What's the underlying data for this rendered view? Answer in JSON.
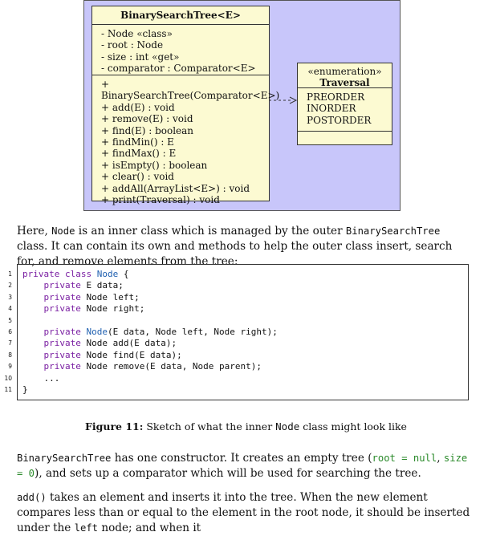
{
  "uml": {
    "class_box": {
      "title": "BinarySearchTree<E>",
      "attributes": [
        "- Node «class»",
        "- root : Node",
        "- size : int «get»",
        "- comparator : Comparator<E>"
      ],
      "operations": [
        "+ BinarySearchTree(Comparator<E>)",
        "+ add(E) : void",
        "+ remove(E) : void",
        "+ find(E) : boolean",
        "+ findMin() : E",
        "+ findMax() : E",
        "+ isEmpty() : boolean",
        "+ clear() : void",
        "+ addAll(ArrayList<E>) : void",
        "+ print(Traversal) : void"
      ]
    },
    "enum_box": {
      "stereotype": "«enumeration»",
      "title": "Traversal",
      "values": [
        "PREORDER",
        "INORDER",
        "POSTORDER"
      ]
    }
  },
  "para1": {
    "t1": "Here, ",
    "c1": "Node",
    "t2": " is an inner class which is managed by the outer ",
    "c2": "BinarySearchTree",
    "t3": " class. It can contain its own and methods to help the outer class insert, search for, and remove elements from the tree:"
  },
  "code": {
    "line_numbers": [
      "1",
      "2",
      "3",
      "4",
      "5",
      "6",
      "7",
      "8",
      "9",
      "10",
      "11"
    ],
    "lines": [
      {
        "kw": "private class ",
        "fn": "Node",
        "rest": " {"
      },
      {
        "kw": "    private ",
        "fn": "",
        "rest": "E data;"
      },
      {
        "kw": "    private ",
        "fn": "",
        "rest": "Node left;"
      },
      {
        "kw": "    private ",
        "fn": "",
        "rest": "Node right;"
      },
      {
        "kw": "",
        "fn": "",
        "rest": ""
      },
      {
        "kw": "    private ",
        "fn": "Node",
        "rest": "(E data, Node left, Node right);"
      },
      {
        "kw": "    private ",
        "fn": "",
        "rest": "Node add(E data);"
      },
      {
        "kw": "    private ",
        "fn": "",
        "rest": "Node find(E data);"
      },
      {
        "kw": "    private ",
        "fn": "",
        "rest": "Node remove(E data, Node parent);"
      },
      {
        "kw": "",
        "fn": "",
        "rest": "    ..."
      },
      {
        "kw": "",
        "fn": "",
        "rest": "}"
      }
    ]
  },
  "caption": {
    "label": "Figure 11:",
    "t1": " Sketch of what the inner ",
    "c1": "Node",
    "t2": " class might look like"
  },
  "para2": {
    "c1": "BinarySearchTree",
    "t1": " has one constructor. It creates an empty tree (",
    "c2": "root = null",
    "t2": ", ",
    "c3": "size = 0",
    "t3": "), and sets up a comparator which will be used for searching the tree."
  },
  "para3": {
    "c1": "add()",
    "t1": " takes an element and inserts it into the tree. When the new element compares less than or equal to the element in the root node, it should be inserted under the ",
    "c2": "left",
    "t2": " node; and when it"
  }
}
